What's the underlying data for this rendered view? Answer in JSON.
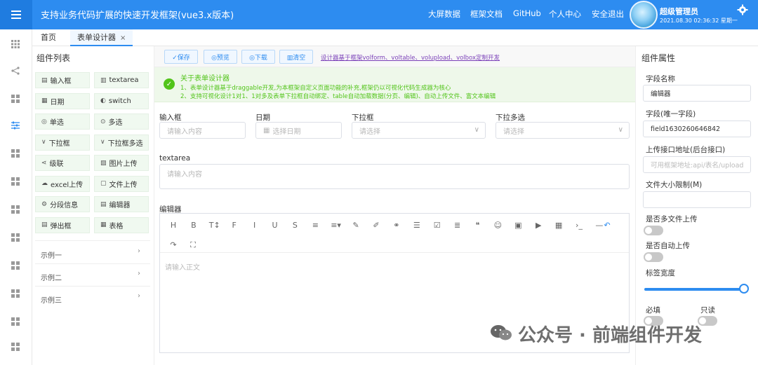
{
  "header": {
    "title": "支持业务代码扩展的快速开发框架(vue3.x版本)",
    "nav": [
      "大屏数据",
      "框架文档",
      "GitHub",
      "个人中心",
      "安全退出"
    ],
    "user_name": "超级管理员",
    "user_time": "2021.08.30 02:36:32 星期一"
  },
  "tabs": {
    "home": "首页",
    "active": "表单设计器",
    "close": "×"
  },
  "components": {
    "title": "组件列表",
    "items": [
      {
        "icon": "input-icon",
        "glyph": "▤",
        "label": "输入框"
      },
      {
        "icon": "textarea-icon",
        "glyph": "▥",
        "label": "textarea"
      },
      {
        "icon": "date-icon",
        "glyph": "▦",
        "label": "日期"
      },
      {
        "icon": "switch-icon",
        "glyph": "◐",
        "label": "switch"
      },
      {
        "icon": "radio-icon",
        "glyph": "◎",
        "label": "单选"
      },
      {
        "icon": "checkbox-icon",
        "glyph": "⊙",
        "label": "多选"
      },
      {
        "icon": "dropdown-icon",
        "glyph": "∨",
        "label": "下拉框"
      },
      {
        "icon": "multi-dropdown-icon",
        "glyph": "∨",
        "label": "下拉框多选"
      },
      {
        "icon": "cascade-icon",
        "glyph": "⋖",
        "label": "级联"
      },
      {
        "icon": "image-icon",
        "glyph": "▨",
        "label": "图片上传"
      },
      {
        "icon": "cloud-icon",
        "glyph": "☁",
        "label": "excel上传"
      },
      {
        "icon": "file-icon",
        "glyph": "▢",
        "label": "文件上传"
      },
      {
        "icon": "section-icon",
        "glyph": "⚙",
        "label": "分段信息"
      },
      {
        "icon": "editor-icon",
        "glyph": "▤",
        "label": "编辑器"
      },
      {
        "icon": "popup-icon",
        "glyph": "▤",
        "label": "弹出框"
      },
      {
        "icon": "table-icon",
        "glyph": "▦",
        "label": "表格"
      }
    ],
    "examples": [
      "示例一",
      "示例二",
      "示例三"
    ]
  },
  "toolbar": {
    "save": "✓保存",
    "preview": "◎预览",
    "download": "◎下载",
    "clear": "▥清空",
    "link": "设计器基于框架volform、voltable、volupload、volbox定制开发"
  },
  "notice": {
    "title": "关于表单设计器",
    "line1": "1、表单设计器基于draggable开发,为本框架自定义页面功能的补充,框架仍以可视化代码生成器为核心",
    "line2": "2、支持可视化设计1对1、1对多及表单下拉框自动绑定、table自动加载数据(分页、编辑)、自动上传文件、富文本编辑"
  },
  "form": {
    "input_label": "输入框",
    "input_placeholder": "请输入内容",
    "date_label": "日期",
    "date_placeholder": "选择日期",
    "select_label": "下拉框",
    "select_placeholder": "请选择",
    "multiselect_label": "下拉多选",
    "multiselect_placeholder": "请选择",
    "textarea_label": "textarea",
    "textarea_placeholder": "请输入内容",
    "editor_label": "编辑器",
    "editor_placeholder": "请输入正文"
  },
  "editor_toolbar": [
    "H",
    "B",
    "T↕",
    "F",
    "I",
    "U",
    "S",
    "≡",
    "≡▾",
    "✎",
    "✐",
    "⚭",
    "☰",
    "☑",
    "≣",
    "❝",
    "☺",
    "▣",
    "▶",
    "▦",
    "›_",
    "—",
    "↶",
    "↷",
    "⛶"
  ],
  "props": {
    "title": "组件属性",
    "field_name_label": "字段名称",
    "field_name_value": "编辑器",
    "field_key_label": "字段(唯一字段)",
    "field_key_value": "field1630260646842",
    "upload_url_label": "上传接口地址(后台接口)",
    "upload_url_placeholder": "可用框架地址:api/表名/upload",
    "file_size_label": "文件大小限制(M)",
    "multi_upload_label": "是否多文件上传",
    "auto_upload_label": "是否自动上传",
    "label_width_label": "标签宽度",
    "label_width_value": 1.0,
    "required_label": "必填",
    "readonly_label": "只读"
  },
  "watermark": "公众号 · 前端组件开发",
  "colors": {
    "primary": "#2d8cf0",
    "success": "#52c41a"
  }
}
